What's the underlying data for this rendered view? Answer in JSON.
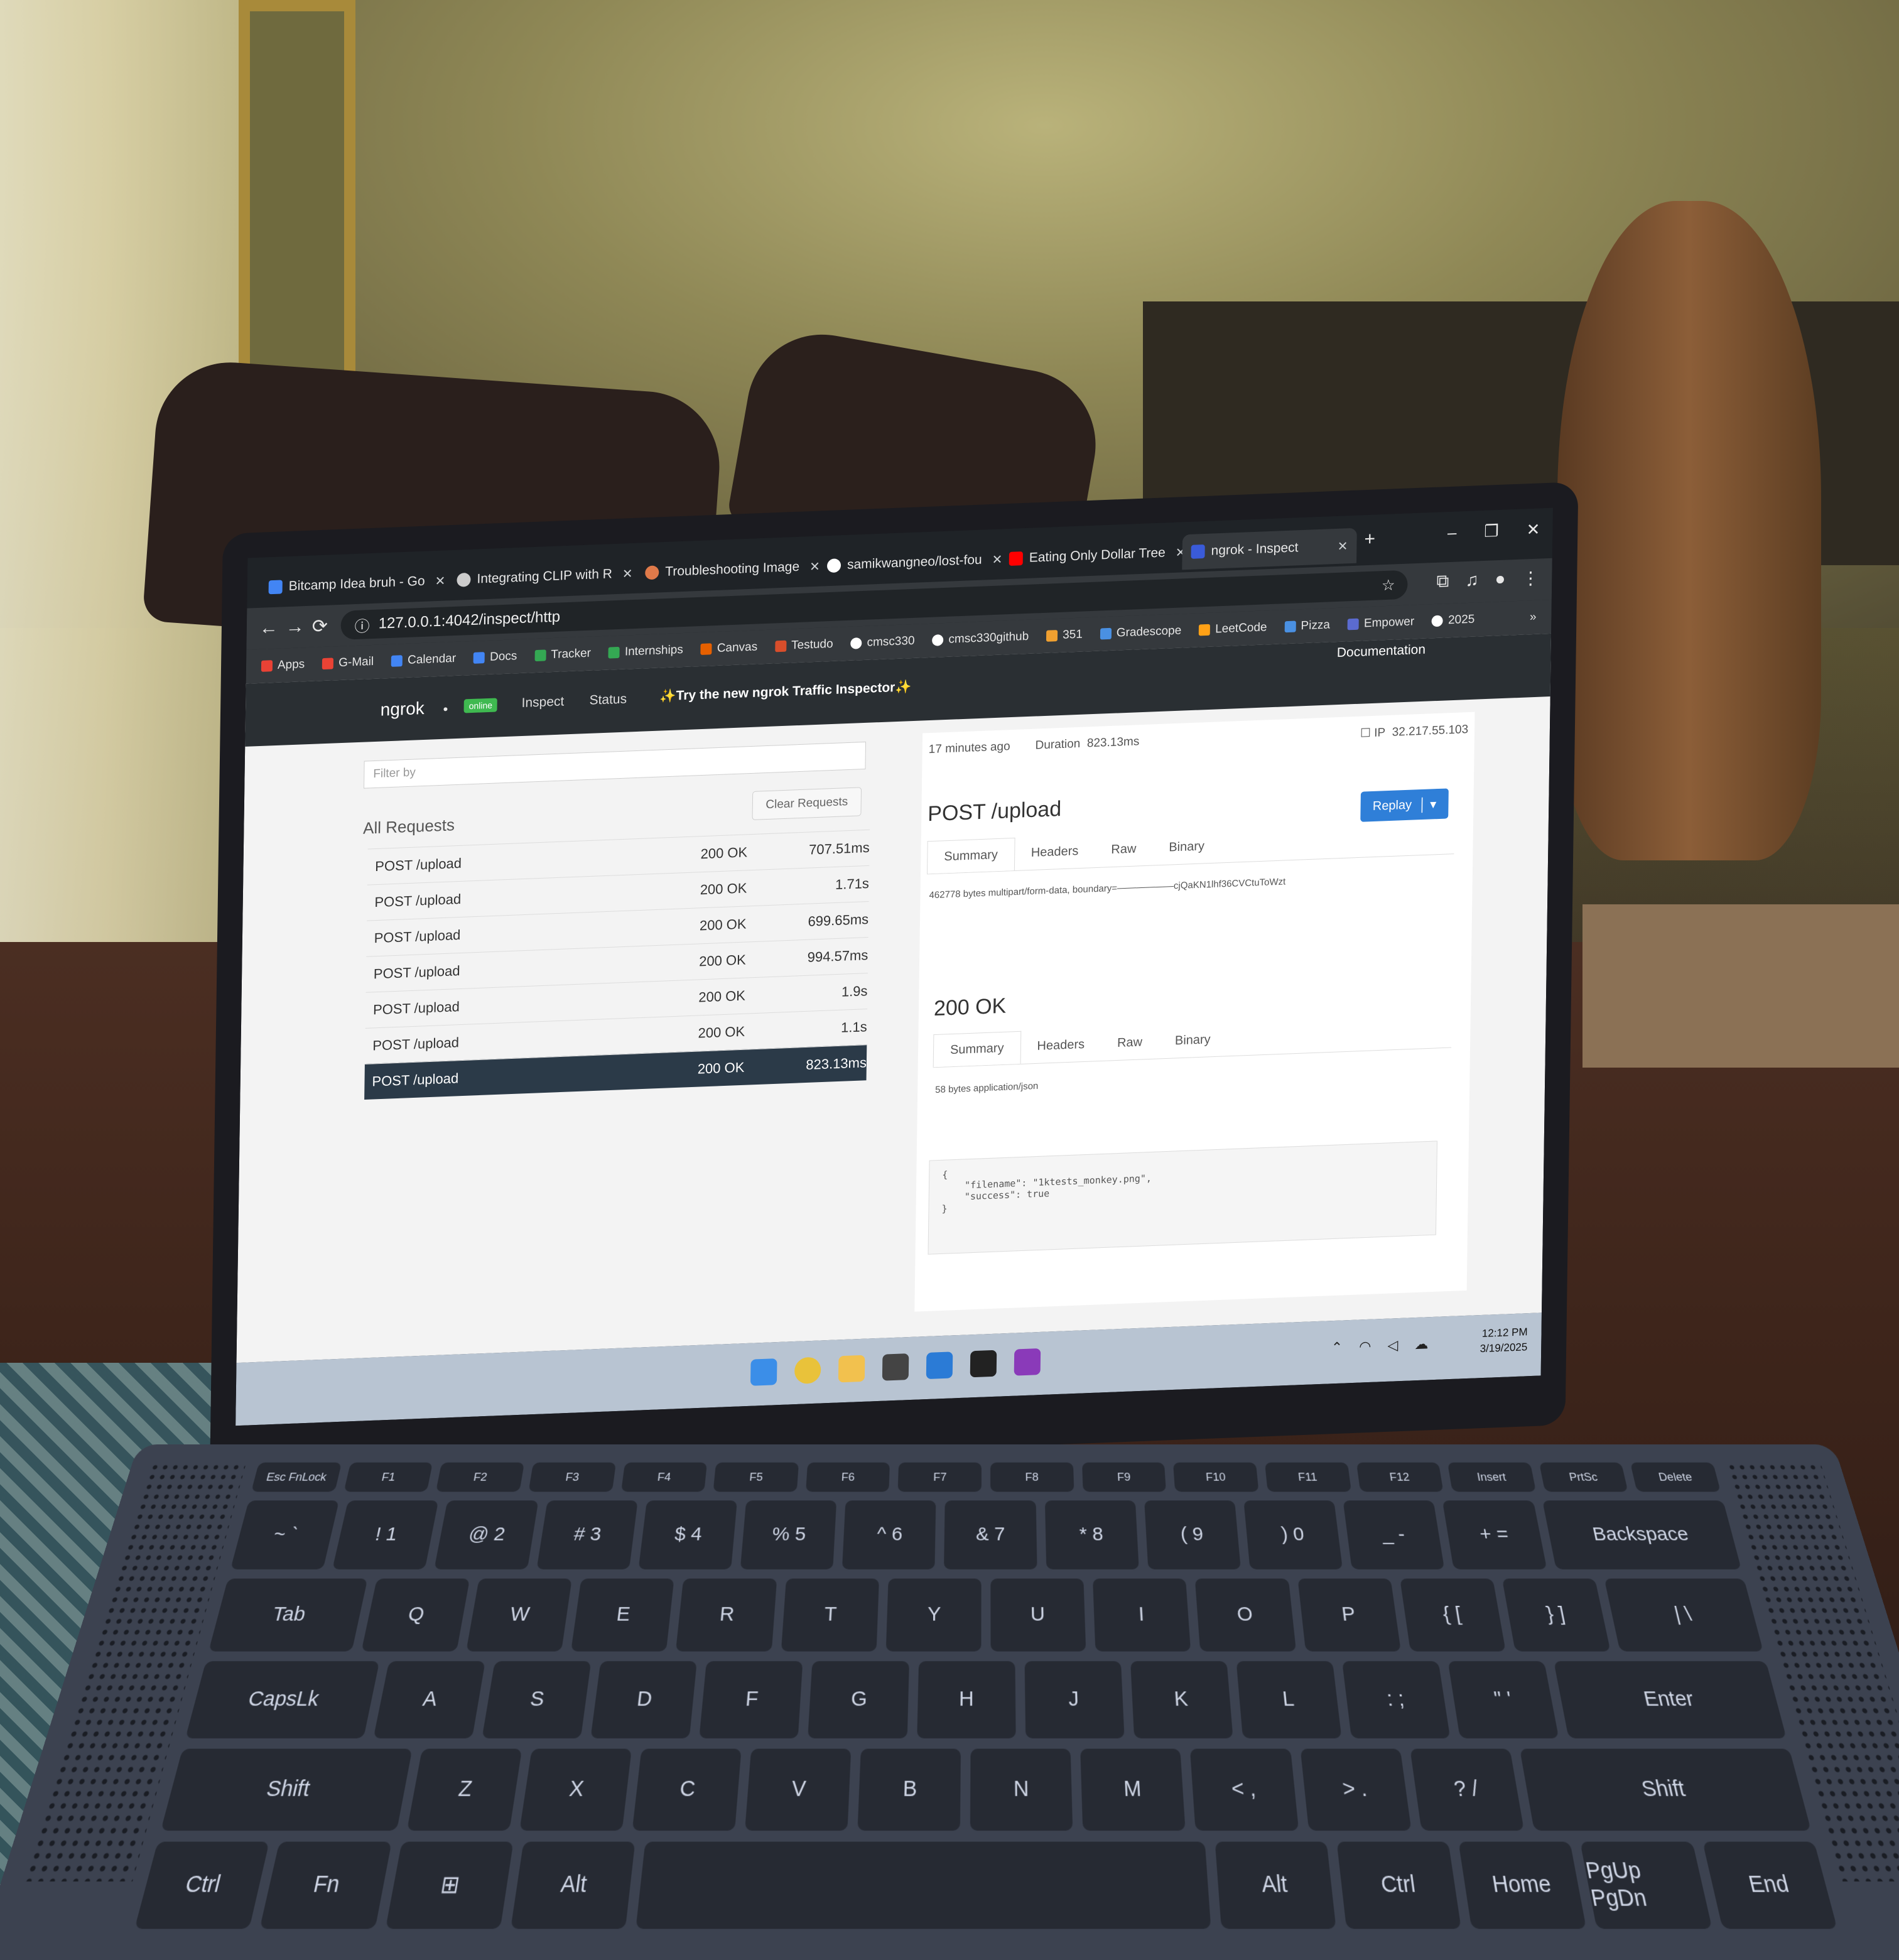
{
  "browser": {
    "tabs": [
      {
        "label": "Bitcamp Idea bruh - Go",
        "color": "#4285f4"
      },
      {
        "label": "Integrating CLIP with R",
        "color": "#cccccc"
      },
      {
        "label": "Troubleshooting Image",
        "color": "#e07a4a"
      },
      {
        "label": "samikwangneo/lost-fou",
        "color": "#ffffff"
      },
      {
        "label": "Eating Only Dollar Tree",
        "color": "#ff0000"
      },
      {
        "label": "ngrok - Inspect",
        "color": "#3a5bd9"
      }
    ],
    "url": "127.0.0.1:4042/inspect/http",
    "bookmarks": [
      {
        "label": "Apps",
        "color": "#e94235"
      },
      {
        "label": "G-Mail",
        "color": "#ea4335"
      },
      {
        "label": "Calendar",
        "color": "#4285f4"
      },
      {
        "label": "Docs",
        "color": "#4285f4"
      },
      {
        "label": "Tracker",
        "color": "#34a853"
      },
      {
        "label": "Internships",
        "color": "#34a853"
      },
      {
        "label": "Canvas",
        "color": "#e66000"
      },
      {
        "label": "Testudo",
        "color": "#d94e2b"
      },
      {
        "label": "cmsc330",
        "color": "#ffffff"
      },
      {
        "label": "cmsc330github",
        "color": "#ffffff"
      },
      {
        "label": "351",
        "color": "#f0a030"
      },
      {
        "label": "Gradescope",
        "color": "#4a90e2"
      },
      {
        "label": "LeetCode",
        "color": "#ffa116"
      },
      {
        "label": "Pizza",
        "color": "#4a90e2"
      },
      {
        "label": "Empower",
        "color": "#5b6bd0"
      },
      {
        "label": "2025",
        "color": "#ffffff"
      }
    ]
  },
  "ngrok": {
    "brand": "ngrok",
    "status": "online",
    "nav_inspect": "Inspect",
    "nav_status": "Status",
    "promo": "✨Try the new ngrok Traffic Inspector✨",
    "documentation": "Documentation",
    "filter_placeholder": "Filter by",
    "clear_requests": "Clear Requests",
    "all_requests": "All Requests",
    "requests": [
      {
        "path": "POST /upload",
        "status": "200 OK",
        "duration": "707.51ms"
      },
      {
        "path": "POST /upload",
        "status": "200 OK",
        "duration": "1.71s"
      },
      {
        "path": "POST /upload",
        "status": "200 OK",
        "duration": "699.65ms"
      },
      {
        "path": "POST /upload",
        "status": "200 OK",
        "duration": "994.57ms"
      },
      {
        "path": "POST /upload",
        "status": "200 OK",
        "duration": "1.9s"
      },
      {
        "path": "POST /upload",
        "status": "200 OK",
        "duration": "1.1s"
      },
      {
        "path": "POST /upload",
        "status": "200 OK",
        "duration": "823.13ms"
      }
    ],
    "detail": {
      "time_ago": "17 minutes ago",
      "duration_label": "Duration",
      "duration_value": "823.13ms",
      "ip_label": "IP",
      "ip_value": "32.217.55.103",
      "request_title": "POST /upload",
      "replay": "Replay",
      "tabs": [
        "Summary",
        "Headers",
        "Raw",
        "Binary"
      ],
      "request_info": "462778 bytes multipart/form-data, boundary=——————cjQaKN1lhf36CVCtuToWzt",
      "response_title": "200 OK",
      "response_info": "58 bytes application/json",
      "response_body": "{\n    \"filename\": \"1ktests_monkey.png\",\n    \"success\": true\n}"
    }
  },
  "taskbar": {
    "time": "12:12 PM",
    "date": "3/19/2025"
  },
  "keyboard": {
    "function_row": [
      "Esc FnLock",
      "F1",
      "F2",
      "F3",
      "F4",
      "F5",
      "F6",
      "F7",
      "F8",
      "F9",
      "F10",
      "F11",
      "F12",
      "Insert",
      "PrtSc",
      "Delete"
    ],
    "number_row": [
      "~ `",
      "! 1",
      "@ 2",
      "# 3",
      "$ 4",
      "% 5",
      "^ 6",
      "& 7",
      "* 8",
      "( 9",
      ") 0",
      "_ -",
      "+ =",
      "Backspace"
    ],
    "top_row": [
      "Tab",
      "Q",
      "W",
      "E",
      "R",
      "T",
      "Y",
      "U",
      "I",
      "O",
      "P",
      "{ [",
      "} ]",
      "| \\"
    ],
    "home_row": [
      "CapsLk",
      "A",
      "S",
      "D",
      "F",
      "G",
      "H",
      "J",
      "K",
      "L",
      ": ;",
      "\" '",
      "Enter"
    ],
    "bottom_row": [
      "Shift",
      "Z",
      "X",
      "C",
      "V",
      "B",
      "N",
      "M",
      "< ,",
      "> .",
      "? /",
      "Shift"
    ],
    "space_row": [
      "Ctrl",
      "Fn",
      "⊞",
      "Alt",
      "",
      "Alt",
      "Ctrl",
      "Home",
      "PgUp PgDn",
      "End"
    ]
  }
}
